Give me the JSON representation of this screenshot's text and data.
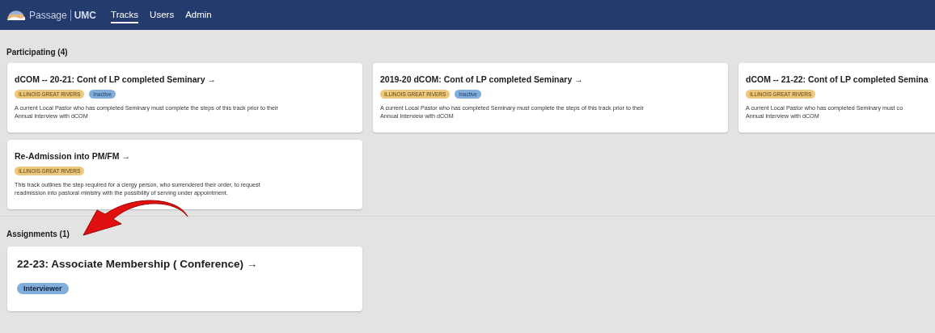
{
  "nav": {
    "brand": "Passage",
    "brand_suffix": "UMC",
    "tabs": [
      {
        "label": "Tracks",
        "selected": true
      },
      {
        "label": "Users",
        "selected": false
      },
      {
        "label": "Admin",
        "selected": false
      }
    ]
  },
  "sections": [
    {
      "title": "Participating (4)",
      "kind": "participating",
      "cards": [
        {
          "title": "dCOM -- 20-21: Cont of LP completed Seminary →",
          "tags": [
            {
              "label": "ILLINOIS GREAT RIVERS",
              "kind": "region"
            },
            {
              "label": "Inactive",
              "kind": "status"
            }
          ],
          "description": "A current Local Pastor who has completed Seminary must complete the steps of this track prior to their\nAnnual Interview with dCOM"
        },
        {
          "title": "2019-20 dCOM: Cont of LP completed Seminary →",
          "tags": [
            {
              "label": "ILLINOIS GREAT RIVERS",
              "kind": "region"
            },
            {
              "label": "Inactive",
              "kind": "status"
            }
          ],
          "description": "A current Local Pastor who has completed Seminary must complete the steps of this track prior to their\nAnnual Interview with dCOM"
        },
        {
          "title": "dCOM -- 21-22: Cont of LP completed Semina",
          "tags": [
            {
              "label": "ILLINOIS GREAT RIVERS",
              "kind": "region"
            }
          ],
          "description": "A current Local Pastor who has completed Seminary must co\nAnnual Interview with dCOM"
        },
        {
          "title": "Re-Admission into PM/FM →",
          "tags": [
            {
              "label": "ILLINOIS GREAT RIVERS",
              "kind": "region"
            }
          ],
          "description": "This track outlines the step required for a clergy person, who surrendered their order, to request\nreadmission into pastoral ministry with the possibility of serving under appointment."
        }
      ]
    },
    {
      "title": "Assignments (1)",
      "kind": "assignments",
      "cards": [
        {
          "title": "22-23: Associate Membership ( Conference)  →",
          "tags": [
            {
              "label": "Interviewer",
              "kind": "role"
            }
          ]
        }
      ]
    }
  ]
}
